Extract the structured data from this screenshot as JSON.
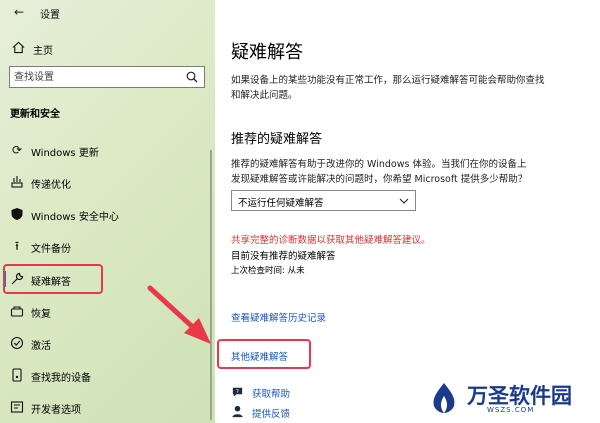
{
  "window": {
    "title": "设置"
  },
  "sidebar": {
    "home": "主页",
    "search_placeholder": "查找设置",
    "section": "更新和安全",
    "items": [
      {
        "label": "Windows 更新",
        "icon": "sync-icon"
      },
      {
        "label": "传递优化",
        "icon": "delivery-icon"
      },
      {
        "label": "Windows 安全中心",
        "icon": "shield-icon"
      },
      {
        "label": "文件备份",
        "icon": "backup-icon"
      },
      {
        "label": "疑难解答",
        "icon": "wrench-icon",
        "selected": true
      },
      {
        "label": "恢复",
        "icon": "recovery-icon"
      },
      {
        "label": "激活",
        "icon": "activation-icon"
      },
      {
        "label": "查找我的设备",
        "icon": "find-device-icon"
      },
      {
        "label": "开发者选项",
        "icon": "developer-icon"
      }
    ]
  },
  "main": {
    "title": "疑难解答",
    "description": "如果设备上的某些功能没有正常工作，那么运行疑难解答可能会帮助你查找和解决此问题。",
    "recommended": {
      "heading": "推荐的疑难解答",
      "description": "推荐的疑难解答有助于改进你的 Windows 体验。当我们在你的设备上发现疑难解答或许能解决的问题时，你希望 Microsoft 提供多少帮助？",
      "dropdown_value": "不运行任何疑难解答",
      "share_link": "共享完整的诊断数据以获取其他疑难解答建议。",
      "status": "目前没有推荐的疑难解答",
      "last_checked": "上次检查时间: 从未"
    },
    "history_link": "查看疑难解答历史记录",
    "other_link": "其他疑难解答",
    "help": "获取帮助",
    "feedback": "提供反馈"
  },
  "logo": {
    "name": "万圣软件园",
    "domain": "WSZS.COM"
  },
  "colors": {
    "accent": "#0a7bd6",
    "highlight_box": "#e8384a",
    "link": "#1a55c2",
    "warning": "#d93036"
  }
}
